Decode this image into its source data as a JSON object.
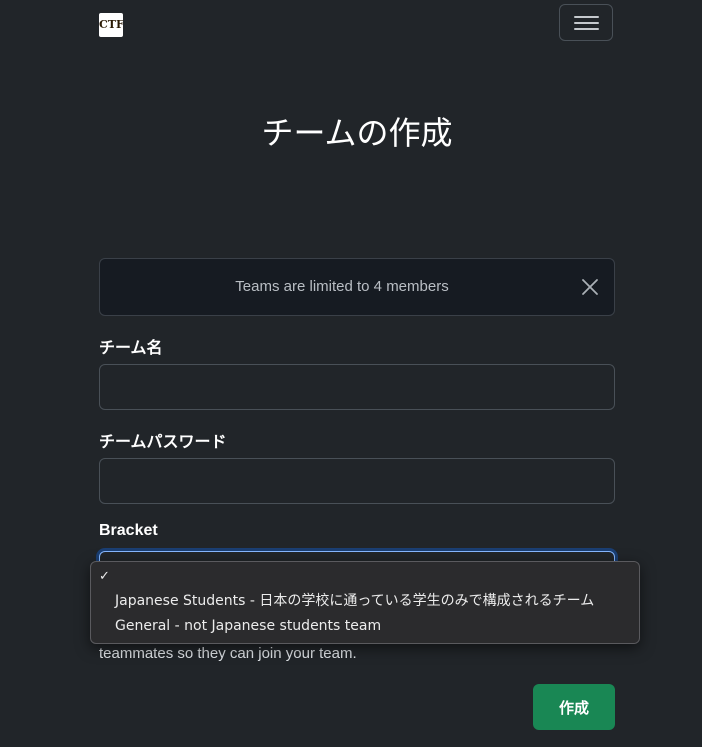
{
  "navbar": {
    "logo_text": "CTF",
    "toggler_icon": "hamburger-icon"
  },
  "page": {
    "title": "チームの作成"
  },
  "alert": {
    "text": "Teams are limited to 4 members",
    "close_icon": "close-icon"
  },
  "form": {
    "team_name_label": "チーム名",
    "team_name_value": "",
    "team_password_label": "チームパスワード",
    "team_password_value": "",
    "bracket_label": "Bracket",
    "bracket_selected": "",
    "help_text": "teammates so they can join your team.",
    "submit_label": "作成"
  },
  "bracket_dropdown": {
    "check_mark": "✓",
    "options": [
      "",
      "Japanese Students - 日本の学校に通っている学生のみで構成されるチーム",
      "General - not Japanese students team"
    ]
  },
  "colors": {
    "background": "#212529",
    "submit_button": "#198754",
    "focus_border": "#86b7fe"
  }
}
